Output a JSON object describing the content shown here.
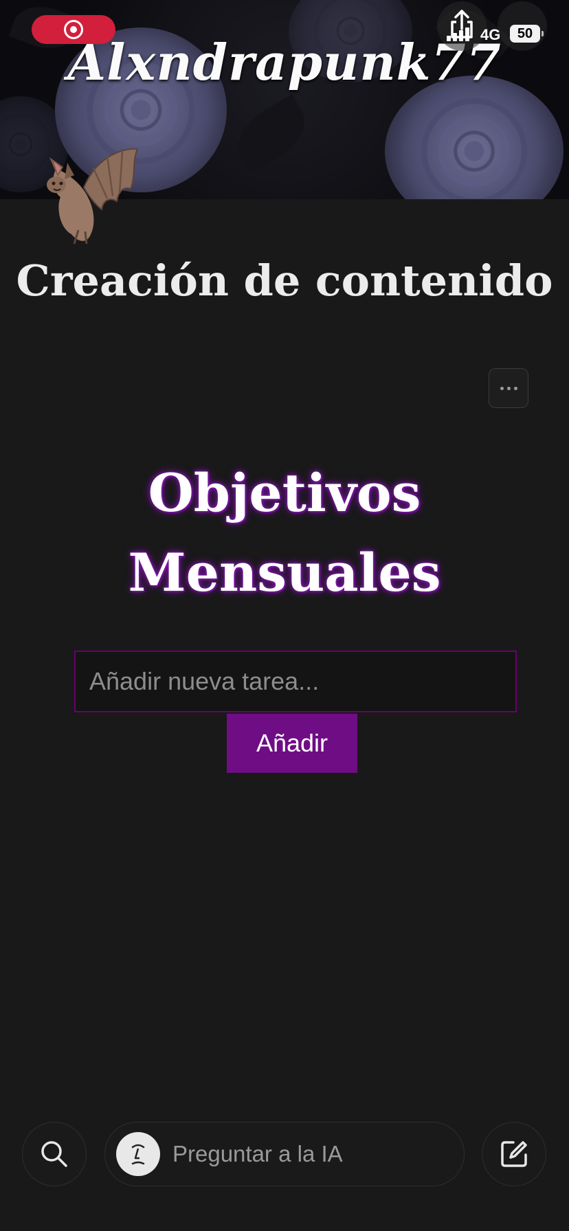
{
  "status_bar": {
    "network": "4G",
    "battery": "50"
  },
  "cover": {
    "title": "Alxndrapunk77"
  },
  "page": {
    "title": "Creación de contenido"
  },
  "goals": {
    "title_line1": "Objetivos",
    "title_line2": "Mensuales",
    "input_placeholder": "Añadir nueva tarea...",
    "add_label": "Añadir",
    "accent": "#6f0d85"
  },
  "bottom_bar": {
    "ai_placeholder": "Preguntar a la IA"
  },
  "icons": [
    "record-icon",
    "share-icon",
    "more-icon",
    "bat-icon",
    "search-icon",
    "ai-face-icon",
    "edit-icon"
  ]
}
